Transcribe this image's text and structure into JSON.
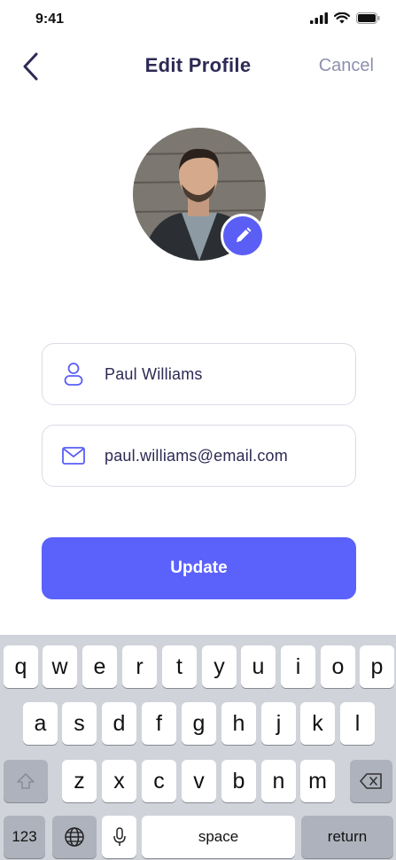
{
  "status_bar": {
    "time": "9:41"
  },
  "nav": {
    "title": "Edit Profile",
    "cancel_label": "Cancel"
  },
  "profile": {
    "name": "Paul Williams",
    "email": "paul.williams@email.com"
  },
  "update_button_label": "Update",
  "keyboard": {
    "row1": [
      "q",
      "w",
      "e",
      "r",
      "t",
      "y",
      "u",
      "i",
      "o",
      "p"
    ],
    "row2": [
      "a",
      "s",
      "d",
      "f",
      "g",
      "h",
      "j",
      "k",
      "l"
    ],
    "row3": [
      "z",
      "x",
      "c",
      "v",
      "b",
      "n",
      "m"
    ],
    "numbers_label": "123",
    "space_label": "space",
    "return_label": "return"
  },
  "colors": {
    "accent": "#5b61fb",
    "title": "#2d2a55",
    "muted": "#8e8fae",
    "keyboard_bg": "#d1d3da"
  },
  "icons": [
    "back-chevron-icon",
    "pencil-icon",
    "user-icon",
    "mail-icon",
    "shift-icon",
    "delete-icon",
    "globe-icon",
    "microphone-icon"
  ]
}
